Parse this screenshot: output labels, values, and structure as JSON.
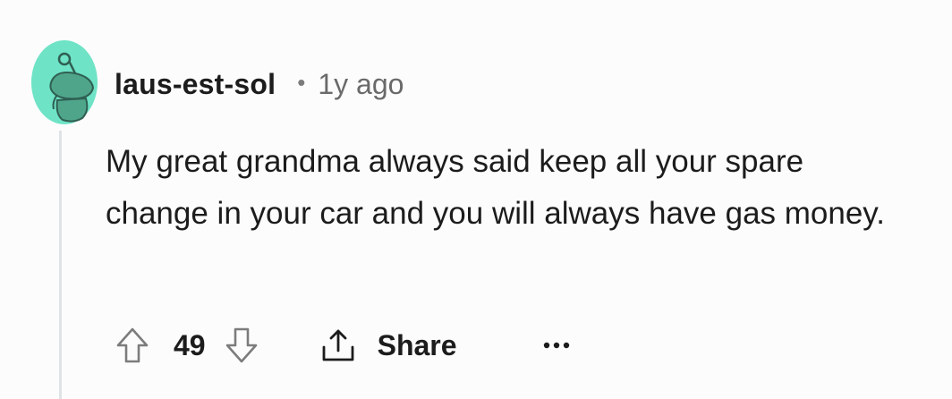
{
  "comment": {
    "username": "laus-est-sol",
    "separator": "•",
    "time_ago": "1y ago",
    "body": "My great grandma always said keep all your spare change in your car and you will always have gas money.",
    "score": "49",
    "share_label": "Share"
  },
  "icons": {
    "avatar": "snoo-avatar-icon",
    "upvote": "arrow-up-icon",
    "downvote": "arrow-down-icon",
    "share": "share-icon",
    "more": "more-options-icon"
  },
  "colors": {
    "avatar_bg": "#6fe3c6",
    "avatar_figure": "#4fa58a",
    "text": "#1c1c1c",
    "muted": "#6a6a6a",
    "icon": "#7c7c7c",
    "thread_line": "#dfe3e6",
    "background": "#fcfcfd"
  }
}
